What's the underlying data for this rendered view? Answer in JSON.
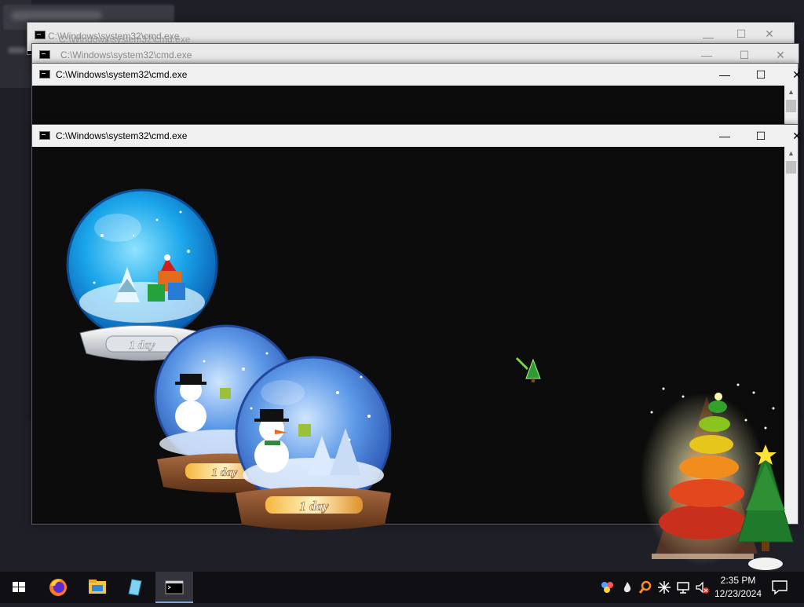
{
  "desktop": {
    "behind_window": {
      "title": "C:\\Windows\\system32\\cmd.exe",
      "title_ghost": "C:\\Windows\\system32\\cmd.exe"
    },
    "windows": [
      {
        "title": "C:\\Windows\\system32\\cmd.exe",
        "minimize": "—",
        "maximize": "☐",
        "close": "✕"
      },
      {
        "title": "C:\\Windows\\system32\\cmd.exe",
        "minimize": "—",
        "maximize": "☐",
        "close": "✕"
      },
      {
        "title": "C:\\Windows\\system32\\cmd.exe",
        "minimize": "—",
        "maximize": "☐",
        "close": "✕"
      }
    ],
    "snow_globes": [
      {
        "label": "1 day",
        "style": "silver"
      },
      {
        "label": "1 day",
        "style": "wood"
      },
      {
        "label": "1 day",
        "style": "wood"
      }
    ]
  },
  "taskbar": {
    "start_icon": "windows-start-icon",
    "pinned": [
      "firefox-icon",
      "file-explorer-icon",
      "notepad-icon",
      "cmd-icon"
    ],
    "tray_icons": [
      "colorful-app-icon",
      "water-drop-icon",
      "search-icon",
      "network-star-icon",
      "monitor-icon",
      "speaker-muted-icon"
    ],
    "clock": {
      "time": "2:35 PM",
      "date": "12/23/2024"
    }
  },
  "colors": {
    "taskbar": "#101014",
    "console": "#0c0c0c",
    "titlebar": "#f0f0f0",
    "accent": "#7aa7d9"
  }
}
